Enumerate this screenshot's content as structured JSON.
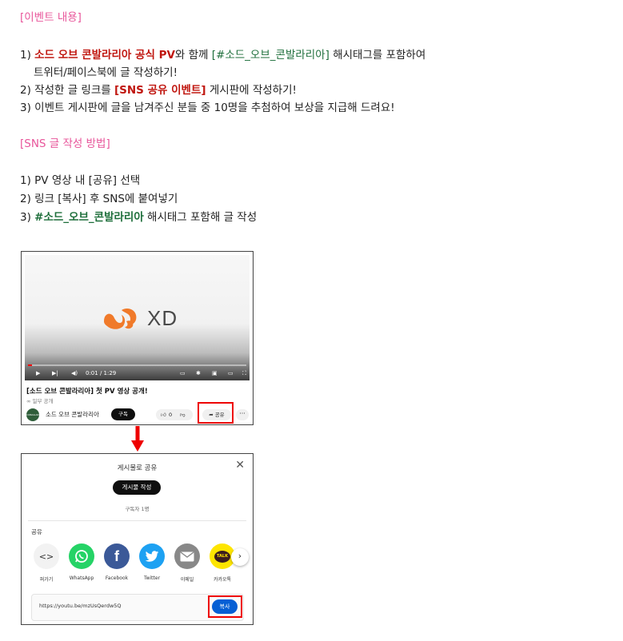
{
  "section1": {
    "heading": "[이벤트 내용]",
    "item1": {
      "num": "1) ",
      "pv": "소드 오브 콘발라리아 공식 PV",
      "with": "와 함께 ",
      "tag": "[#소드_오브_콘발라리아]",
      "rest": " 해시태그를 포함하여",
      "line2": "트위터/페이스북에 글 작성하기!"
    },
    "item2": {
      "num": "2) ",
      "pre": "작성한 글 링크를 ",
      "board": "[SNS 공유 이벤트]",
      "post": " 게시판에 작성하기!"
    },
    "item3": "3) 이벤트 게시판에 글을 남겨주신 분들 중 10명을 추첨하여 보상을 지급해 드려요!"
  },
  "section2": {
    "heading": "[SNS 글 작성 방법]",
    "step1": "1) PV 영상 내 [공유] 선택",
    "step2": "2) 링크 [복사] 후 SNS에 붙여넣기",
    "step3": {
      "num": "3) ",
      "tag": "#소드_오브_콘발라리아",
      "rest": " 해시태그 포함해 글 작성"
    }
  },
  "video": {
    "logo_text": "XD",
    "time": "0:01 / 1:29",
    "progress": 0.02,
    "title": "[소드 오브 콘발라리아] 첫 PV 영상 공개!",
    "subtitle": "∞ 일부 공개",
    "channel_avatar_text": "CONVALLARIA",
    "channel": "소드 오브 콘발라리아",
    "subscribe": "구독",
    "likes": "0",
    "share": "공유",
    "more": "···"
  },
  "dialog": {
    "title": "게시물로 공유",
    "post_button": "게시물 작성",
    "subscriber_count": "구독자 1명",
    "share_label": "공유",
    "items": [
      {
        "label": "퍼가기",
        "icon": "embed-icon",
        "color": "#f2f2f2"
      },
      {
        "label": "WhatsApp",
        "icon": "whatsapp-icon",
        "color": "#25d366"
      },
      {
        "label": "Facebook",
        "icon": "facebook-icon",
        "color": "#3b5998"
      },
      {
        "label": "Twitter",
        "icon": "twitter-icon",
        "color": "#1da1f2"
      },
      {
        "label": "이메일",
        "icon": "email-icon",
        "color": "#888888"
      },
      {
        "label": "카카오톡",
        "icon": "kakaotalk-icon",
        "color": "#fee500"
      }
    ],
    "kakao_badge": "TALK",
    "url": "https://youtu.be/mzUsQerdw5Q",
    "copy_button": "복사"
  },
  "colors": {
    "heading": "#e8559a",
    "pv_link": "#c0160f",
    "hashtag": "#1d6e3a",
    "highlight": "#e00000"
  }
}
